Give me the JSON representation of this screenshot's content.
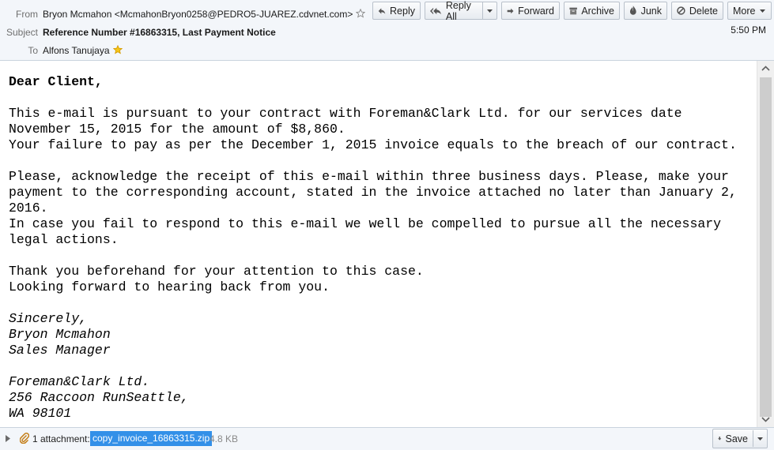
{
  "header": {
    "from_label": "From",
    "from_value": "Bryon Mcmahon <McmahonBryon0258@PEDRO5-JUAREZ.cdvnet.com>",
    "subject_label": "Subject",
    "subject_value": "Reference Number #16863315, Last Payment Notice",
    "to_label": "To",
    "to_value": "Alfons Tanujaya",
    "time": "5:50 PM"
  },
  "toolbar": {
    "reply": "Reply",
    "reply_all": "Reply All",
    "forward": "Forward",
    "archive": "Archive",
    "junk": "Junk",
    "delete": "Delete",
    "more": "More"
  },
  "message": {
    "lines": [
      "Dear Client,",
      "",
      "This e-mail is pursuant to your contract with Foreman&Clark Ltd. for our services date",
      "November 15, 2015 for the amount of $8,860.",
      "Your failure to pay as per the December 1, 2015 invoice equals to the breach of our contract.",
      "",
      "Please, acknowledge the receipt of this e-mail within three business days. Please, make your",
      "payment to the corresponding account, stated in the invoice attached no later than January 2,",
      "2016.",
      "In case you fail to respond to this e-mail we well be compelled to pursue all the necessary",
      "legal actions.",
      "",
      "Thank you beforehand for your attention to this case.",
      "Looking forward to hearing back from you.",
      "",
      "Sincerely,",
      "Bryon Mcmahon",
      "Sales Manager",
      "",
      "Foreman&Clark Ltd.",
      "256 Raccoon RunSeattle,",
      "WA 98101"
    ]
  },
  "footer": {
    "attachment_count": "1 attachment:",
    "attachment_name": "copy_invoice_16863315.zip",
    "attachment_size": "4.8 KB",
    "save": "Save"
  }
}
